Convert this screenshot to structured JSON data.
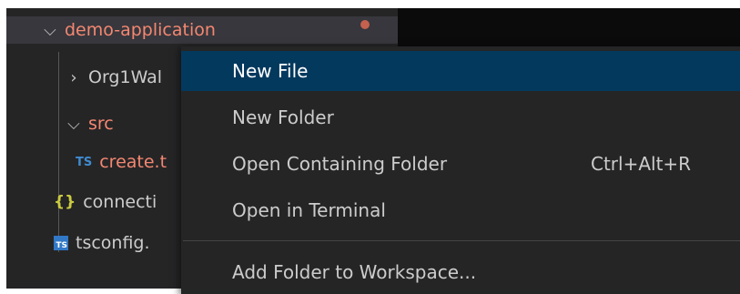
{
  "explorer": {
    "root": {
      "label": "demo-application"
    },
    "items": [
      {
        "label": "Org1Wal"
      },
      {
        "label": "src"
      },
      {
        "label": "create.t",
        "icon_text": "TS"
      },
      {
        "label": "connecti",
        "icon_text": "{}"
      },
      {
        "label": "tsconfig.",
        "icon_text": "TS"
      }
    ]
  },
  "context_menu": {
    "items": [
      {
        "label": "New File",
        "selected": true
      },
      {
        "label": "New Folder"
      },
      {
        "label": "Open Containing Folder",
        "shortcut": "Ctrl+Alt+R"
      },
      {
        "label": "Open in Terminal"
      },
      {
        "label": "Add Folder to Workspace..."
      }
    ]
  },
  "colors": {
    "panel_bg": "#252526",
    "selection": "#04395e",
    "modified_text": "#f48771",
    "ts_icon": "#3178c6",
    "json_icon": "#cbcb41"
  }
}
